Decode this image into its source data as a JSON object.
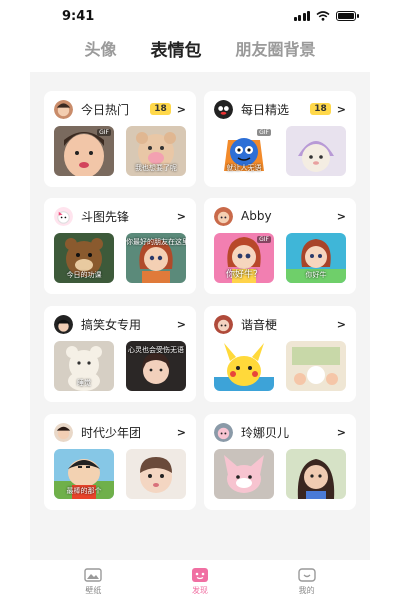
{
  "status": {
    "time": "9:41"
  },
  "tabs": [
    {
      "label": "头像",
      "active": false
    },
    {
      "label": "表情包",
      "active": true
    },
    {
      "label": "朋友圈背景",
      "active": false
    }
  ],
  "cards": [
    {
      "title": "今日热门",
      "badge": "18",
      "arrow": ">",
      "thumbs": [
        {
          "caption": "",
          "gif": "GIF"
        },
        {
          "caption": "我也想要了呢",
          "gif": ""
        }
      ]
    },
    {
      "title": "每日精选",
      "badge": "18",
      "arrow": ">",
      "thumbs": [
        {
          "caption": "就让人无语",
          "gif": "GIF"
        },
        {
          "caption": "",
          "gif": ""
        }
      ]
    },
    {
      "title": "斗图先锋",
      "badge": "",
      "arrow": ">",
      "thumbs": [
        {
          "caption": "今日的功课",
          "gif": ""
        },
        {
          "caption": "你最好的朋友在这里",
          "gif": ""
        }
      ]
    },
    {
      "title": "Abby",
      "badge": "",
      "arrow": ">",
      "thumbs": [
        {
          "caption": "你好牛？",
          "gif": "GIF"
        },
        {
          "caption": "你好牛",
          "gif": ""
        }
      ]
    },
    {
      "title": "搞笑女专用",
      "badge": "",
      "arrow": ">",
      "thumbs": [
        {
          "caption": "睡觉",
          "gif": ""
        },
        {
          "caption": "心灵也会受伤无语",
          "gif": ""
        }
      ]
    },
    {
      "title": "谐音梗",
      "badge": "",
      "arrow": ">",
      "thumbs": [
        {
          "caption": "",
          "gif": ""
        },
        {
          "caption": "",
          "gif": ""
        }
      ]
    },
    {
      "title": "时代少年团",
      "badge": "",
      "arrow": ">",
      "thumbs": [
        {
          "caption": "最棒的那个",
          "gif": ""
        },
        {
          "caption": "",
          "gif": ""
        }
      ]
    },
    {
      "title": "玲娜贝儿",
      "badge": "",
      "arrow": ">",
      "thumbs": [
        {
          "caption": "",
          "gif": ""
        },
        {
          "caption": "",
          "gif": ""
        }
      ]
    }
  ],
  "bottom_nav": [
    {
      "label": "壁纸",
      "icon": "wallpaper-icon",
      "active": false
    },
    {
      "label": "发现",
      "icon": "discover-icon",
      "active": true
    },
    {
      "label": "我的",
      "icon": "profile-icon",
      "active": false
    }
  ],
  "colors": {
    "accent": "#f06fa2",
    "badge": "#ffd84a",
    "background": "#f4f4f4"
  }
}
